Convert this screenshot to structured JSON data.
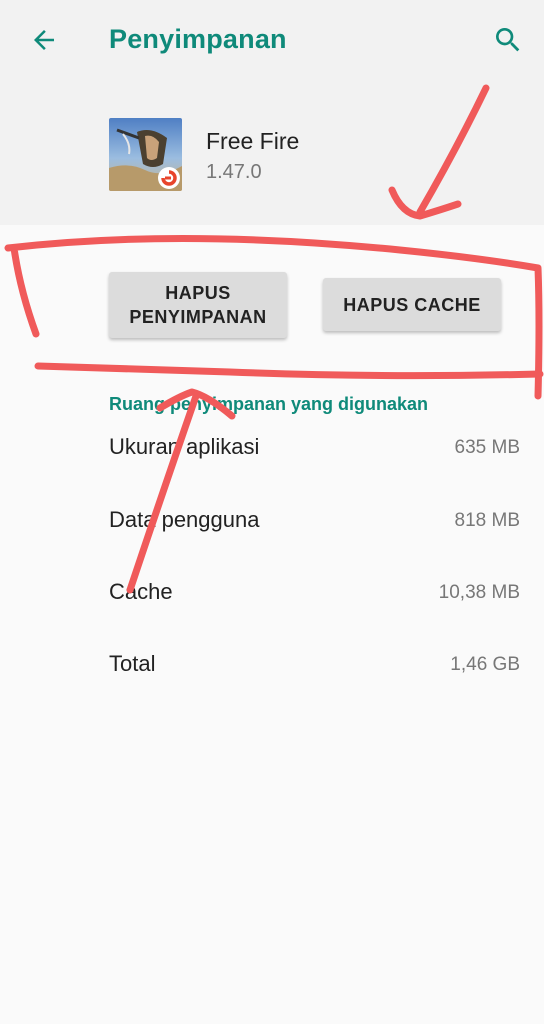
{
  "header": {
    "title": "Penyimpanan",
    "back_icon": "arrow-left-icon",
    "search_icon": "search-icon",
    "accent_color": "#0f8a7a"
  },
  "app": {
    "name": "Free Fire",
    "version": "1.47.0",
    "icon": "free-fire-app-icon"
  },
  "buttons": {
    "clear_storage_line1": "HAPUS",
    "clear_storage_line2": "PENYIMPANAN",
    "clear_cache": "HAPUS CACHE"
  },
  "storage": {
    "section_title": "Ruang penyimpanan yang digunakan",
    "rows": [
      {
        "label": "Ukuran aplikasi",
        "value": "635 MB"
      },
      {
        "label": "Data pengguna",
        "value": "818 MB"
      },
      {
        "label": "Cache",
        "value": "10,38 MB"
      },
      {
        "label": "Total",
        "value": "1,46 GB"
      }
    ]
  },
  "annotation_color": "#f05a5a"
}
